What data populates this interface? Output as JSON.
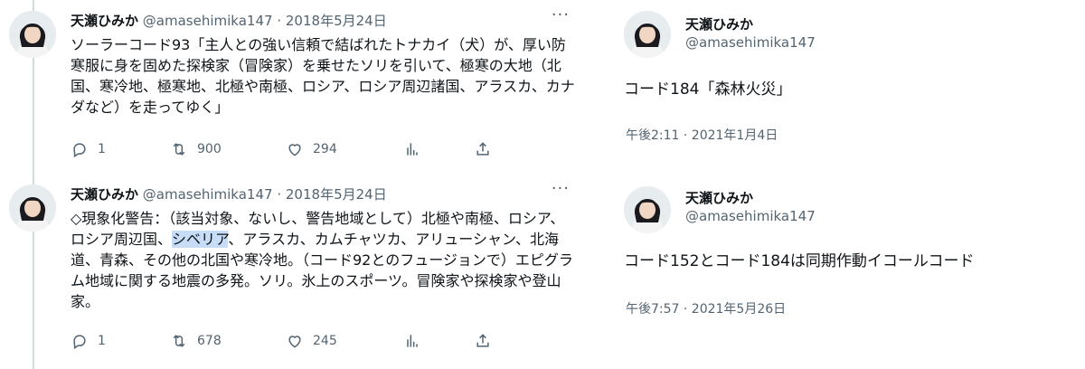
{
  "tweets": [
    {
      "name": "天瀬ひみか",
      "handle": "@amasehimika147",
      "dot": "·",
      "date": "2018年5月24日",
      "more": "···",
      "text": "ソーラーコード93「主人との強い信頼で結ばれたトナカイ（犬）が、厚い防寒服に身を固めた探検家（冒険家）を乗せたソリを引いて、極寒の大地（北国、寒冷地、極寒地、北極や南極、ロシア、ロシア周辺諸国、アラスカ、カナダなど）を走ってゆく」",
      "replies": "1",
      "retweets": "900",
      "likes": "294"
    },
    {
      "name": "天瀬ひみか",
      "handle": "@amasehimika147",
      "dot": "·",
      "date": "2018年5月24日",
      "more": "···",
      "text_before": "◇現象化警告：（該当対象、ないし、警告地域として）北極や南極、ロシア、ロシア周辺国、",
      "text_highlight": "シベリア",
      "text_after": "、アラスカ、カムチャツカ、アリューシャン、北海道、青森、その他の北国や寒冷地。（コード92とのフュージョンで）エピグラム地域に関する地震の多発。ソリ。氷上のスポーツ。冒険家や探検家や登山家。",
      "replies": "1",
      "retweets": "678",
      "likes": "245"
    }
  ],
  "cards": [
    {
      "name": "天瀬ひみか",
      "handle": "@amasehimika147",
      "text": "コード184「森林火災」",
      "date": "午後2:11 · 2021年1月4日"
    },
    {
      "name": "天瀬ひみか",
      "handle": "@amasehimika147",
      "text": "コード152とコード184は同期作動イコールコード",
      "date": "午後7:57 · 2021年5月26日"
    }
  ],
  "icons": [
    "reply-icon",
    "retweet-icon",
    "like-icon",
    "views-icon",
    "share-icon",
    "more-icon"
  ],
  "colors": {
    "text": "#0f1419",
    "secondary": "#536471",
    "highlight": "#c6dcf7",
    "thread_line": "#cfd9de"
  }
}
